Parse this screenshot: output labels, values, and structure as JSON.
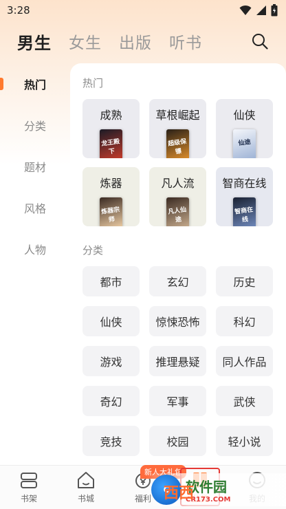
{
  "status_bar": {
    "time": "3:28"
  },
  "header": {
    "tabs": [
      {
        "label": "男生",
        "active": true
      },
      {
        "label": "女生",
        "active": false
      },
      {
        "label": "出版",
        "active": false
      },
      {
        "label": "听书",
        "active": false
      }
    ],
    "search_icon": "search-icon"
  },
  "left_nav": {
    "items": [
      {
        "label": "热门",
        "active": true
      },
      {
        "label": "分类",
        "active": false
      },
      {
        "label": "题材",
        "active": false
      },
      {
        "label": "风格",
        "active": false
      },
      {
        "label": "人物",
        "active": false
      }
    ]
  },
  "hot": {
    "title": "热门",
    "cards": [
      {
        "label": "成熟",
        "bg": "#ebebf0",
        "cover_colors": [
          "#1b1b26",
          "#c13a2b"
        ],
        "cover_text": "龙王殿下"
      },
      {
        "label": "草根崛起",
        "bg": "#ebebf0",
        "cover_colors": [
          "#2a2118",
          "#d88a2a"
        ],
        "cover_text": "超级保镖"
      },
      {
        "label": "仙侠",
        "bg": "#ebebf0",
        "cover_colors": [
          "#f4f6fb",
          "#9fb4d6"
        ],
        "cover_text": "仙途"
      },
      {
        "label": "炼器",
        "bg": "#efefe6",
        "cover_colors": [
          "#3a2a22",
          "#e6c7a0"
        ],
        "cover_text": "炼器宗师"
      },
      {
        "label": "凡人流",
        "bg": "#efefe6",
        "cover_colors": [
          "#3b2b22",
          "#c2a78a"
        ],
        "cover_text": "凡人仙途"
      },
      {
        "label": "智商在线",
        "bg": "#e6e8f0",
        "cover_colors": [
          "#1a2132",
          "#6d86b8"
        ],
        "cover_text": "智商在线"
      }
    ]
  },
  "categories": {
    "title": "分类",
    "items": [
      "都市",
      "玄幻",
      "历史",
      "仙侠",
      "惊悚恐怖",
      "科幻",
      "游戏",
      "推理悬疑",
      "同人作品",
      "奇幻",
      "军事",
      "武侠",
      "竞技",
      "校园",
      "轻小说"
    ]
  },
  "bottom_nav": {
    "items": [
      {
        "label": "书架",
        "icon": "bookshelf-icon"
      },
      {
        "label": "书城",
        "icon": "home-icon"
      },
      {
        "label": "福利",
        "icon": "gift-icon"
      },
      {
        "label": "分类",
        "icon": "category-icon"
      },
      {
        "label": "我的",
        "icon": "profile-icon"
      }
    ],
    "promo_badge": "新人大礼包"
  },
  "watermark": {
    "name": "软件园",
    "url": "CR173.COM",
    "inner_text": "西西"
  },
  "colors": {
    "accent": "#ff7a2e",
    "highlight": "#e53935"
  }
}
